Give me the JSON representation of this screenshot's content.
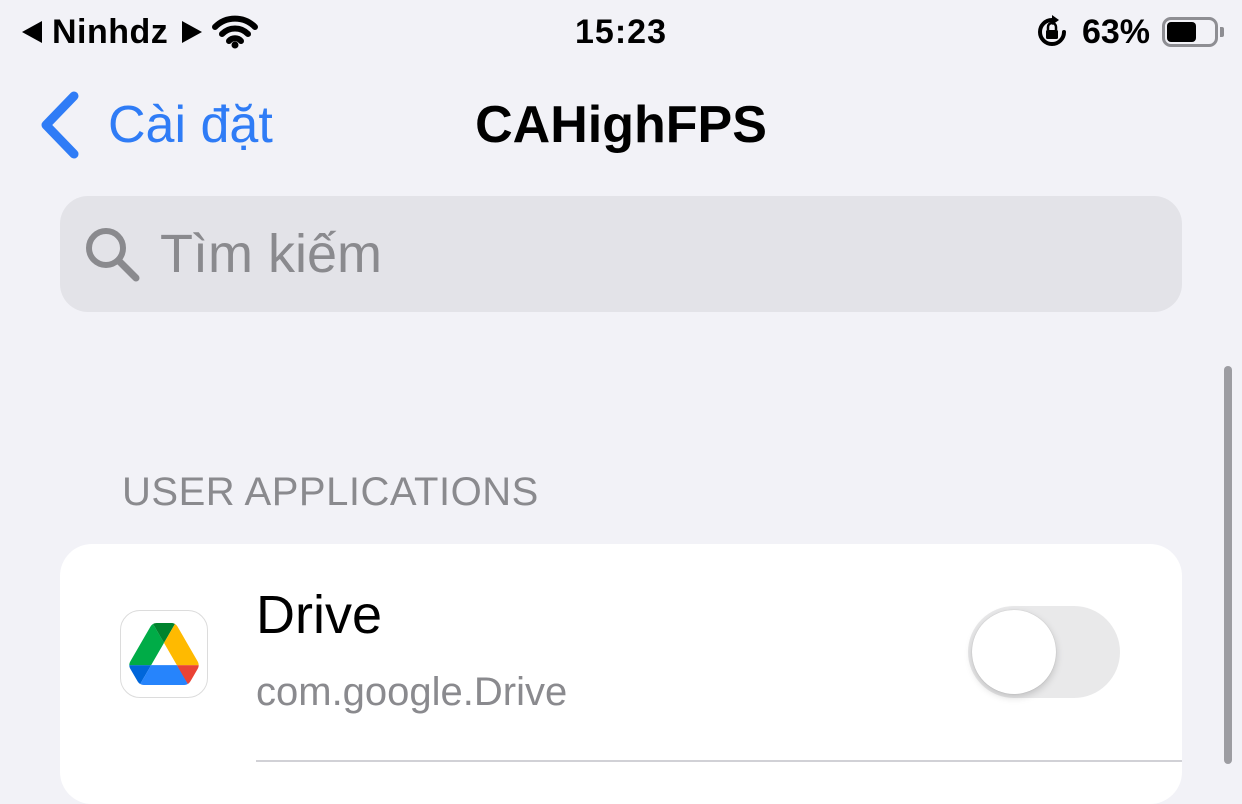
{
  "status_bar": {
    "carrier": "Ninhdz",
    "time": "15:23",
    "battery_percent": "63%",
    "battery_level": 0.63,
    "icons": [
      "back-to-app-icon",
      "location-arrow-icon",
      "wifi-icon",
      "orientation-lock-icon",
      "battery-icon"
    ]
  },
  "nav": {
    "back_label": "Cài đặt",
    "title": "CAHighFPS"
  },
  "search": {
    "placeholder": "Tìm kiếm"
  },
  "section": {
    "header": "USER APPLICATIONS"
  },
  "apps": [
    {
      "name": "Drive",
      "bundle_id": "com.google.Drive",
      "enabled": false,
      "icon": "google-drive-icon"
    }
  ],
  "colors": {
    "accent": "#2f7cf6",
    "background": "#f2f2f7",
    "secondary_text": "#8a8a8e",
    "toggle_off": "#e9e9ea"
  }
}
